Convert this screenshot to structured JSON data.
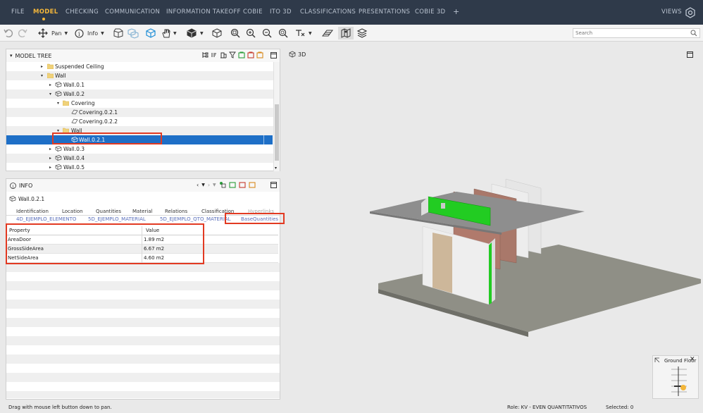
{
  "menu": {
    "items": [
      "FILE",
      "MODEL",
      "CHECKING",
      "COMMUNICATION",
      "INFORMATION TAKEOFF",
      "COBIE",
      "ITO 3D",
      "CLASSIFICATIONS",
      "PRESENTATIONS",
      "COBIE 3D"
    ],
    "active": "MODEL",
    "add_label": "+",
    "views_label": "VIEWS"
  },
  "toolbar": {
    "pan_label": "Pan",
    "info_label": "Info",
    "search_placeholder": "Search"
  },
  "model_tree": {
    "title": "MODEL TREE",
    "rows": [
      {
        "label": "Suspended Ceiling",
        "icon": "folder-icon",
        "twisty": "▸",
        "indent": 1
      },
      {
        "label": "Wall",
        "icon": "folder-icon",
        "twisty": "▾",
        "indent": 1
      },
      {
        "label": "Wall.0.1",
        "icon": "wall-icon",
        "twisty": "▸",
        "indent": 2
      },
      {
        "label": "Wall.0.2",
        "icon": "wall-icon",
        "twisty": "▾",
        "indent": 2
      },
      {
        "label": "Covering",
        "icon": "folder-icon",
        "twisty": "▾",
        "indent": 3
      },
      {
        "label": "Covering.0.2.1",
        "icon": "covering-icon",
        "twisty": "",
        "indent": 4
      },
      {
        "label": "Covering.0.2.2",
        "icon": "covering-icon",
        "twisty": "",
        "indent": 4
      },
      {
        "label": "Wall",
        "icon": "folder-icon",
        "twisty": "▾",
        "indent": 3
      },
      {
        "label": "Wall.0.2.1",
        "icon": "wall-icon",
        "twisty": "",
        "indent": 4,
        "selected": true
      },
      {
        "label": "Wall.0.3",
        "icon": "wall-icon",
        "twisty": "▸",
        "indent": 2
      },
      {
        "label": "Wall.0.4",
        "icon": "wall-icon",
        "twisty": "▸",
        "indent": 2
      },
      {
        "label": "Wall.0.5",
        "icon": "wall-icon",
        "twisty": "▸",
        "indent": 2
      }
    ]
  },
  "info": {
    "title": "INFO",
    "object_name": "Wall.0.2.1",
    "tabs_row1": [
      "Identification",
      "Location",
      "Quantities",
      "Material",
      "Relations",
      "Classification",
      "Hyperlinks"
    ],
    "tabs_row2": [
      "4D_EJEMPLO_ELEMENTO",
      "5D_EJEMPLO_MATERIAL",
      "5D_EJEMPLO_QTO_MATERIAL",
      "BaseQuantities"
    ],
    "columns": [
      "Property",
      "Value"
    ],
    "rows": [
      {
        "property": "AreaDoor",
        "value": "1.89 m2"
      },
      {
        "property": "GrossSideArea",
        "value": "6.67 m2"
      },
      {
        "property": "NetSideArea",
        "value": "4.60 m2"
      }
    ]
  },
  "view3d": {
    "title": "3D",
    "floor_label": "Ground Floor"
  },
  "status": {
    "hint": "Drag with mouse left button down to pan.",
    "role": "Role: KV - EVEN QUANTITATIVOS",
    "selected": "Selected: 0"
  },
  "colors": {
    "topbar": "#2f3a4a",
    "accent": "#f3b63a",
    "selection": "#1e6fc7",
    "highlight": "#e23a22",
    "green": "#22cc22"
  }
}
